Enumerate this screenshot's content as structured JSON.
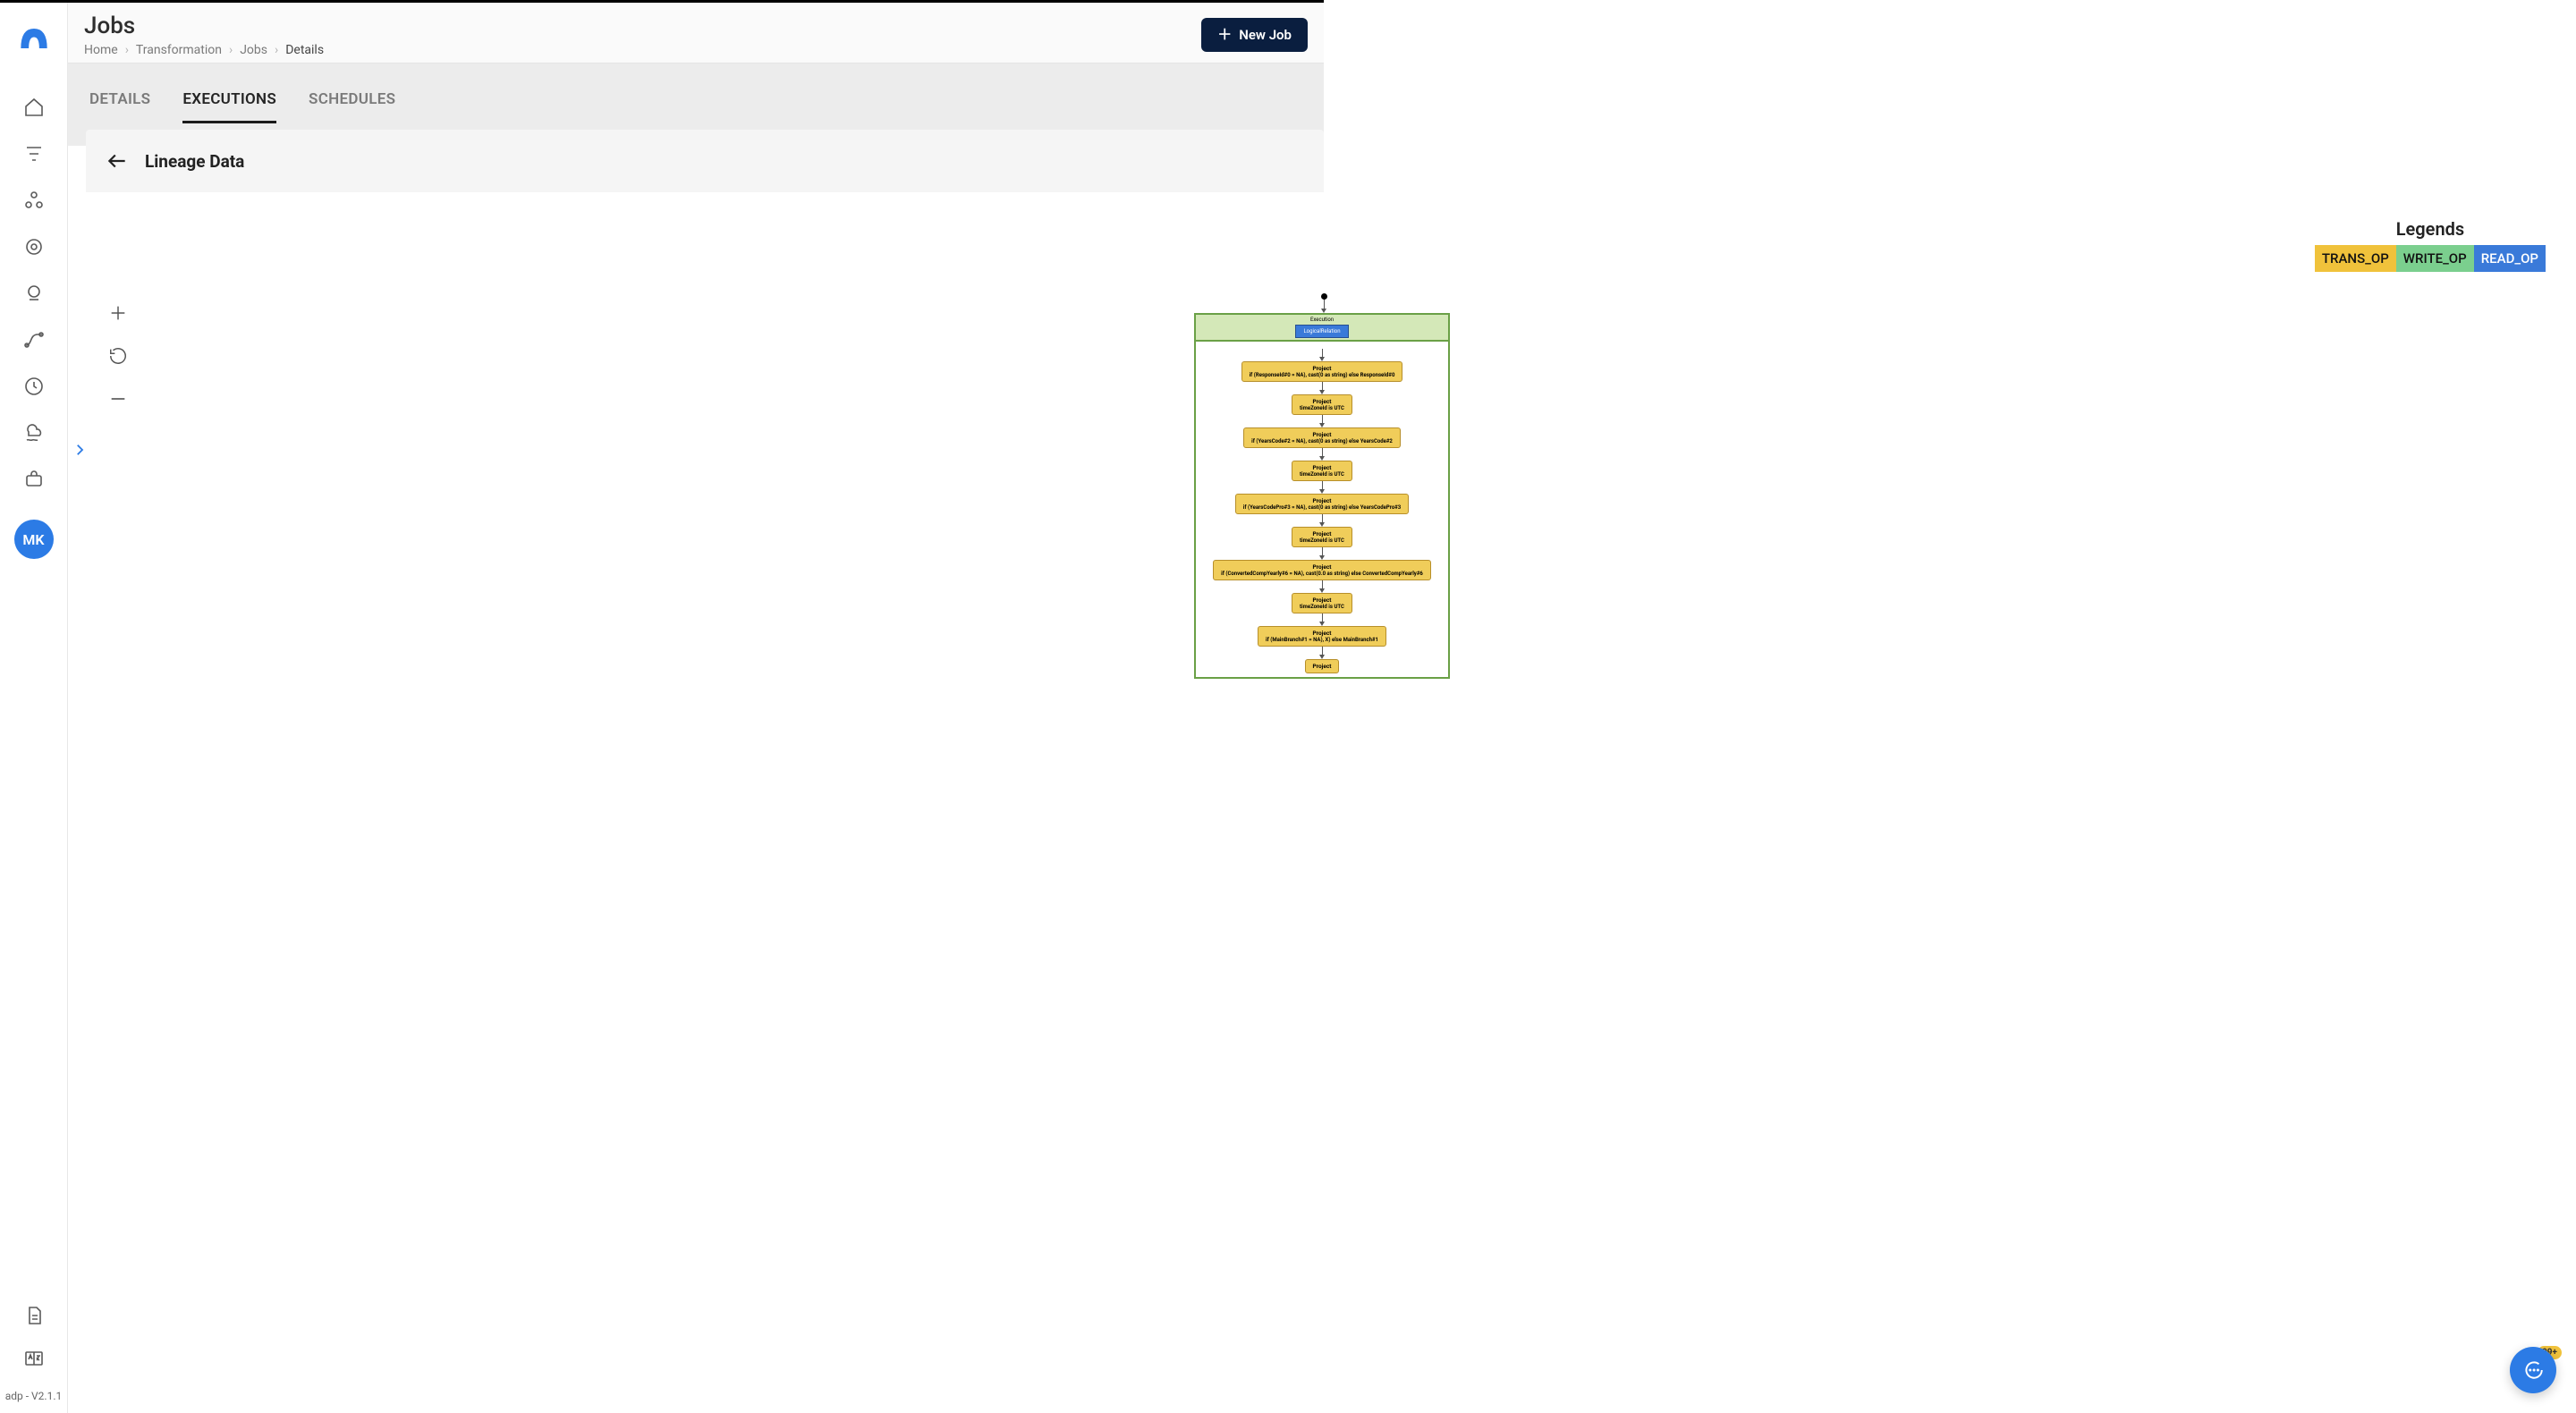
{
  "page_title": "Jobs",
  "breadcrumb": {
    "home": "Home",
    "transformation": "Transformation",
    "jobs": "Jobs",
    "details": "Details"
  },
  "new_job_btn": "New Job",
  "tabs": {
    "details": "DETAILS",
    "executions": "EXECUTIONS",
    "schedules": "SCHEDULES"
  },
  "panel_title": "Lineage Data",
  "legends": {
    "title": "Legends",
    "trans": "TRANS_OP",
    "write": "WRITE_OP",
    "read": "READ_OP"
  },
  "diagram": {
    "execution_label": "Execution",
    "logical_relation": "LogicalRelation",
    "nodes": [
      {
        "t1": "Project",
        "t2": "if (ResponseId#0 = NA), cast(0 as string) else ResponseId#0"
      },
      {
        "t1": "Project",
        "t2": "timeZoneId is UTC"
      },
      {
        "t1": "Project",
        "t2": "if (YearsCode#2 = NA), cast(0 as string) else YearsCode#2"
      },
      {
        "t1": "Project",
        "t2": "timeZoneId is UTC"
      },
      {
        "t1": "Project",
        "t2": "if (YearsCodePro#3 = NA), cast(0 as string) else YearsCodePro#3"
      },
      {
        "t1": "Project",
        "t2": "timeZoneId is UTC"
      },
      {
        "t1": "Project",
        "t2": "if (ConvertedCompYearly#6 = NA), cast(0.0 as string) else ConvertedCompYearly#6"
      },
      {
        "t1": "Project",
        "t2": "timeZoneId is UTC"
      },
      {
        "t1": "Project",
        "t2": "if (MainBranch#1 = NA), X) else MainBranch#1"
      },
      {
        "t1": "Project",
        "t2": ""
      }
    ]
  },
  "avatar": "MK",
  "version": "adp - V2.1.1",
  "help_badge": "99+"
}
